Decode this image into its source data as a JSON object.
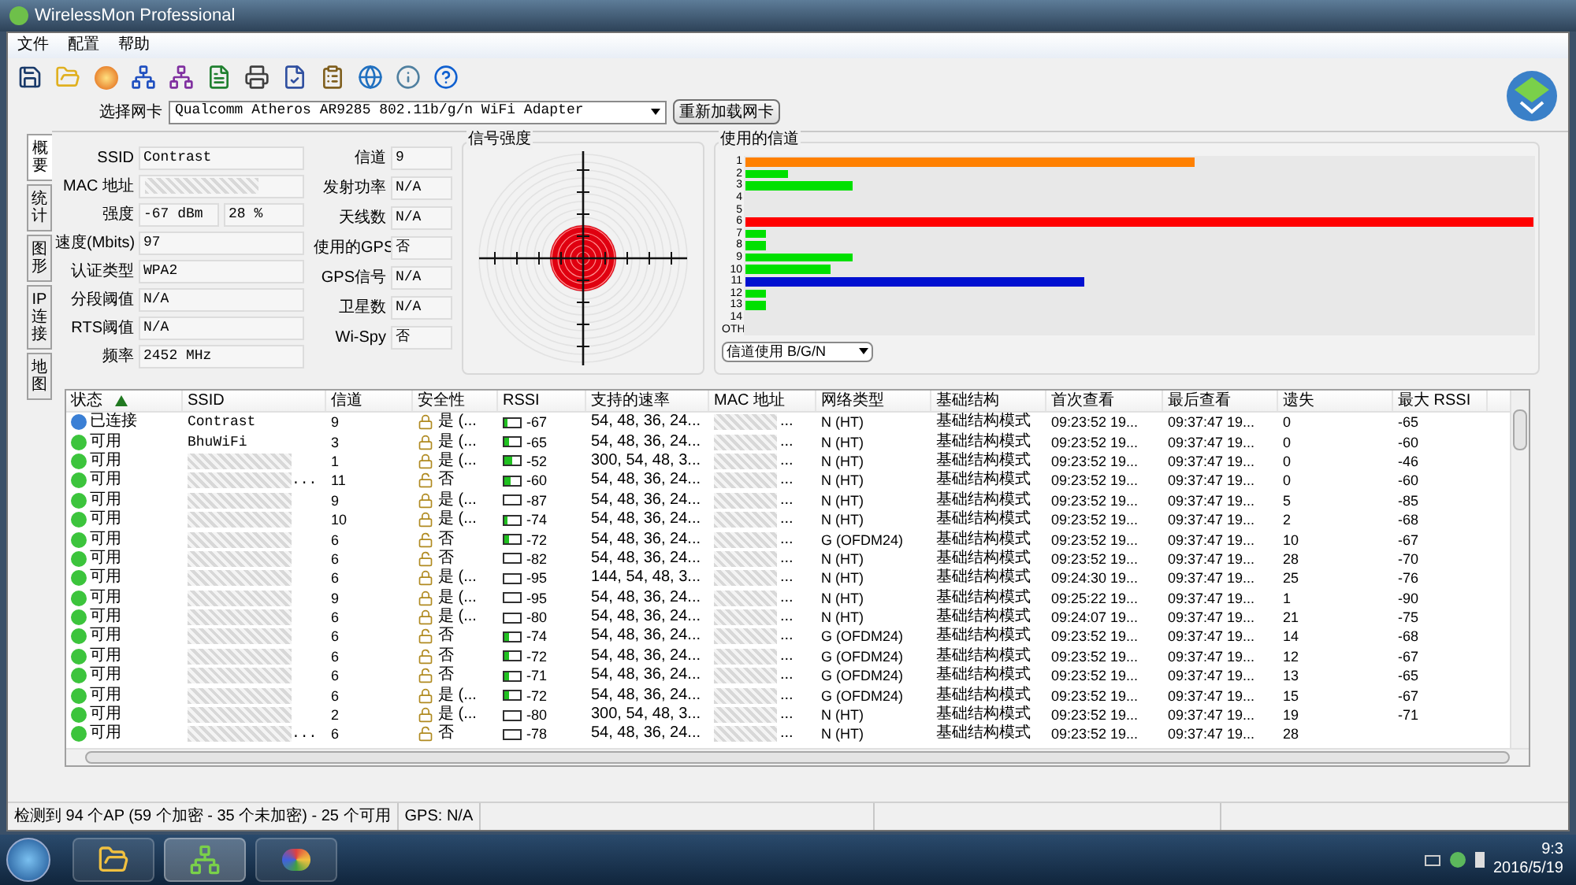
{
  "window": {
    "title": "WirelessMon Professional"
  },
  "menu": [
    "文件",
    "配置",
    "帮助"
  ],
  "adapter": {
    "label": "选择网卡",
    "value": "Qualcomm Atheros AR9285 802.11b/g/n WiFi Adapter",
    "reload_button": "重新加载网卡"
  },
  "side_tabs": [
    {
      "label": "概要",
      "selected": true
    },
    {
      "label": "统计",
      "selected": false
    },
    {
      "label": "图形",
      "selected": false
    },
    {
      "label": "IP 连接",
      "selected": false
    },
    {
      "label": "地图",
      "selected": false
    }
  ],
  "info_left": [
    {
      "label": "SSID",
      "values": [
        "Contrast"
      ],
      "redacted": false
    },
    {
      "label": "MAC 地址",
      "redacted": true
    },
    {
      "label": "强度",
      "values": [
        "-67 dBm",
        "28 %"
      ],
      "redacted": false
    },
    {
      "label": "速度(Mbits)",
      "values": [
        "97"
      ],
      "redacted": false
    },
    {
      "label": "认证类型",
      "values": [
        "WPA2"
      ],
      "redacted": false
    },
    {
      "label": "分段阈值",
      "values": [
        "N/A"
      ],
      "redacted": false
    },
    {
      "label": "RTS阈值",
      "values": [
        "N/A"
      ],
      "redacted": false
    },
    {
      "label": "频率",
      "values": [
        "2452 MHz"
      ],
      "redacted": false
    }
  ],
  "info_right": [
    {
      "label": "信道",
      "value": "9"
    },
    {
      "label": "发射功率",
      "value": "N/A"
    },
    {
      "label": "天线数",
      "value": "N/A"
    },
    {
      "label": "使用的GPS",
      "value": "否"
    },
    {
      "label": "GPS信号",
      "value": "N/A"
    },
    {
      "label": "卫星数",
      "value": "N/A"
    },
    {
      "label": "Wi-Spy",
      "value": "否"
    }
  ],
  "signal": {
    "title": "信号强度"
  },
  "channels": {
    "title": "使用的信道",
    "filter": "信道使用 B/G/N",
    "bars": [
      {
        "label": "1",
        "level": 0.57,
        "color": "#ff8000"
      },
      {
        "label": "2",
        "level": 0.053,
        "color": "#00e000"
      },
      {
        "label": "3",
        "level": 0.135,
        "color": "#00e000"
      },
      {
        "label": "4",
        "level": 0
      },
      {
        "label": "5",
        "level": 0
      },
      {
        "label": "6",
        "level": 1,
        "color": "#ff0000"
      },
      {
        "label": "7",
        "level": 0.026,
        "color": "#00e000"
      },
      {
        "label": "8",
        "level": 0.026,
        "color": "#00e000"
      },
      {
        "label": "9",
        "level": 0.135,
        "color": "#00e000"
      },
      {
        "label": "10",
        "level": 0.107,
        "color": "#00e000"
      },
      {
        "label": "11",
        "level": 0.43,
        "color": "#0010d0"
      },
      {
        "label": "12",
        "level": 0.026,
        "color": "#00e000"
      },
      {
        "label": "13",
        "level": 0.026,
        "color": "#00e000"
      },
      {
        "label": "14",
        "level": 0
      },
      {
        "label": "OTH",
        "level": 0
      }
    ]
  },
  "table": {
    "columns": [
      {
        "label": "状态",
        "sorted": true
      },
      {
        "label": "SSID",
        "sorted": false
      },
      {
        "label": "信道",
        "sorted": false
      },
      {
        "label": "安全性",
        "sorted": false
      },
      {
        "label": "RSSI",
        "sorted": false
      },
      {
        "label": "支持的速率",
        "sorted": false
      },
      {
        "label": "MAC 地址",
        "sorted": false
      },
      {
        "label": "网络类型",
        "sorted": false
      },
      {
        "label": "基础结构",
        "sorted": false
      },
      {
        "label": "首次查看",
        "sorted": false
      },
      {
        "label": "最后查看",
        "sorted": false
      },
      {
        "label": "遗失",
        "sorted": false
      },
      {
        "label": "最大 RSSI",
        "sorted": false
      }
    ],
    "rows": [
      {
        "status": "已连接",
        "color": "#3a7fd5",
        "ssid": "Contrast",
        "ssid_redacted": false,
        "channel": "9",
        "secure": true,
        "security": "是 (...",
        "level": 0.15,
        "rssi": "-67",
        "rates": "54, 48, 36, 24...",
        "mac": "...",
        "network_type": "N (HT)",
        "infrastructure": "基础结构模式",
        "first_seen": "09:23:52 19...",
        "last_seen": "09:37:47 19...",
        "lost": "0",
        "max_rssi": "-65"
      },
      {
        "status": "可用",
        "color": "#3cc43c",
        "ssid": "BhuWiFi",
        "ssid_redacted": false,
        "channel": "3",
        "secure": true,
        "security": "是 (...",
        "level": 0.3,
        "rssi": "-65",
        "rates": "54, 48, 36, 24...",
        "mac": "...",
        "network_type": "N (HT)",
        "infrastructure": "基础结构模式",
        "first_seen": "09:23:52 19...",
        "last_seen": "09:37:47 19...",
        "lost": "0",
        "max_rssi": "-60"
      },
      {
        "status": "可用",
        "color": "#3cc43c",
        "ssid_redacted": true,
        "channel": "1",
        "secure": true,
        "security": "是 (...",
        "level": 0.5,
        "rssi": "-52",
        "rates": "300, 54, 48, 3...",
        "mac": "...",
        "network_type": "N (HT)",
        "infrastructure": "基础结构模式",
        "first_seen": "09:23:52 19...",
        "last_seen": "09:37:47 19...",
        "lost": "0",
        "max_rssi": "-46"
      },
      {
        "status": "可用",
        "color": "#3cc43c",
        "ssid": "...",
        "ssid_redacted": true,
        "channel": "11",
        "secure": false,
        "security": "否",
        "level": 0.4,
        "rssi": "-60",
        "rates": "54, 48, 36, 24...",
        "mac": "...",
        "network_type": "N (HT)",
        "infrastructure": "基础结构模式",
        "first_seen": "09:23:52 19...",
        "last_seen": "09:37:47 19...",
        "lost": "0",
        "max_rssi": "-60"
      },
      {
        "status": "可用",
        "color": "#3cc43c",
        "ssid_redacted": true,
        "channel": "9",
        "secure": true,
        "security": "是 (...",
        "level": 0,
        "rssi": "-87",
        "rates": "54, 48, 36, 24...",
        "mac": "...",
        "network_type": "N (HT)",
        "infrastructure": "基础结构模式",
        "first_seen": "09:23:52 19...",
        "last_seen": "09:37:47 19...",
        "lost": "5",
        "max_rssi": "-85"
      },
      {
        "status": "可用",
        "color": "#3cc43c",
        "ssid_redacted": true,
        "channel": "10",
        "secure": true,
        "security": "是 (...",
        "level": 0.2,
        "rssi": "-74",
        "rates": "54, 48, 36, 24...",
        "mac": "...",
        "network_type": "N (HT)",
        "infrastructure": "基础结构模式",
        "first_seen": "09:23:52 19...",
        "last_seen": "09:37:47 19...",
        "lost": "2",
        "max_rssi": "-68"
      },
      {
        "status": "可用",
        "color": "#3cc43c",
        "ssid_redacted": true,
        "channel": "6",
        "secure": false,
        "security": "否",
        "level": 0.25,
        "rssi": "-72",
        "rates": "54, 48, 36, 24...",
        "mac": "...",
        "network_type": "G (OFDM24)",
        "infrastructure": "基础结构模式",
        "first_seen": "09:23:52 19...",
        "last_seen": "09:37:47 19...",
        "lost": "10",
        "max_rssi": "-67"
      },
      {
        "status": "可用",
        "color": "#3cc43c",
        "ssid_redacted": true,
        "channel": "6",
        "secure": false,
        "security": "否",
        "level": 0,
        "rssi": "-82",
        "rates": "54, 48, 36, 24...",
        "mac": "...",
        "network_type": "N (HT)",
        "infrastructure": "基础结构模式",
        "first_seen": "09:23:52 19...",
        "last_seen": "09:37:47 19...",
        "lost": "28",
        "max_rssi": "-70"
      },
      {
        "status": "可用",
        "color": "#3cc43c",
        "ssid_redacted": true,
        "channel": "6",
        "secure": true,
        "security": "是 (...",
        "level": 0,
        "rssi": "-95",
        "rates": "144, 54, 48, 3...",
        "mac": "...",
        "network_type": "N (HT)",
        "infrastructure": "基础结构模式",
        "first_seen": "09:24:30 19...",
        "last_seen": "09:37:47 19...",
        "lost": "25",
        "max_rssi": "-76"
      },
      {
        "status": "可用",
        "color": "#3cc43c",
        "ssid_redacted": true,
        "channel": "9",
        "secure": true,
        "security": "是 (...",
        "level": 0,
        "rssi": "-95",
        "rates": "54, 48, 36, 24...",
        "mac": "...",
        "network_type": "N (HT)",
        "infrastructure": "基础结构模式",
        "first_seen": "09:25:22 19...",
        "last_seen": "09:37:47 19...",
        "lost": "1",
        "max_rssi": "-90"
      },
      {
        "status": "可用",
        "color": "#3cc43c",
        "ssid_redacted": true,
        "channel": "6",
        "secure": true,
        "security": "是 (...",
        "level": 0,
        "rssi": "-80",
        "rates": "54, 48, 36, 24...",
        "mac": "...",
        "network_type": "N (HT)",
        "infrastructure": "基础结构模式",
        "first_seen": "09:24:07 19...",
        "last_seen": "09:37:47 19...",
        "lost": "21",
        "max_rssi": "-75"
      },
      {
        "status": "可用",
        "color": "#3cc43c",
        "ssid_redacted": true,
        "channel": "6",
        "secure": false,
        "security": "否",
        "level": 0.25,
        "rssi": "-74",
        "rates": "54, 48, 36, 24...",
        "mac": "...",
        "network_type": "G (OFDM24)",
        "infrastructure": "基础结构模式",
        "first_seen": "09:23:52 19...",
        "last_seen": "09:37:47 19...",
        "lost": "14",
        "max_rssi": "-68"
      },
      {
        "status": "可用",
        "color": "#3cc43c",
        "ssid_redacted": true,
        "channel": "6",
        "secure": false,
        "security": "否",
        "level": 0.25,
        "rssi": "-72",
        "rates": "54, 48, 36, 24...",
        "mac": "...",
        "network_type": "G (OFDM24)",
        "infrastructure": "基础结构模式",
        "first_seen": "09:23:52 19...",
        "last_seen": "09:37:47 19...",
        "lost": "12",
        "max_rssi": "-67"
      },
      {
        "status": "可用",
        "color": "#3cc43c",
        "ssid_redacted": true,
        "channel": "6",
        "secure": false,
        "security": "否",
        "level": 0.25,
        "rssi": "-71",
        "rates": "54, 48, 36, 24...",
        "mac": "...",
        "network_type": "G (OFDM24)",
        "infrastructure": "基础结构模式",
        "first_seen": "09:23:52 19...",
        "last_seen": "09:37:47 19...",
        "lost": "13",
        "max_rssi": "-65"
      },
      {
        "status": "可用",
        "color": "#3cc43c",
        "ssid_redacted": true,
        "channel": "6",
        "secure": true,
        "security": "是 (...",
        "level": 0.25,
        "rssi": "-72",
        "rates": "54, 48, 36, 24...",
        "mac": "...",
        "network_type": "G (OFDM24)",
        "infrastructure": "基础结构模式",
        "first_seen": "09:23:52 19...",
        "last_seen": "09:37:47 19...",
        "lost": "15",
        "max_rssi": "-67"
      },
      {
        "status": "可用",
        "color": "#3cc43c",
        "ssid_redacted": true,
        "channel": "2",
        "secure": true,
        "security": "是 (...",
        "level": 0,
        "rssi": "-80",
        "rates": "300, 54, 48, 3...",
        "mac": "...",
        "network_type": "N (HT)",
        "infrastructure": "基础结构模式",
        "first_seen": "09:23:52 19...",
        "last_seen": "09:37:47 19...",
        "lost": "19",
        "max_rssi": "-71"
      },
      {
        "status": "可用",
        "color": "#3cc43c",
        "ssid": "...",
        "ssid_redacted": true,
        "channel": "6",
        "secure": false,
        "security": "否",
        "level": 0,
        "rssi": "-78",
        "rates": "54, 48, 36, 24...",
        "mac": "...",
        "network_type": "N (HT)",
        "infrastructure": "基础结构模式",
        "first_seen": "09:23:52 19...",
        "last_seen": "09:37:47 19...",
        "lost": "28"
      }
    ]
  },
  "status_bar": [
    "检测到 94 个AP (59 个加密 - 35 个未加密) - 25 个可用",
    "GPS: N/A"
  ],
  "taskbar": {
    "time": "9:3",
    "date": "2016/5/19"
  }
}
